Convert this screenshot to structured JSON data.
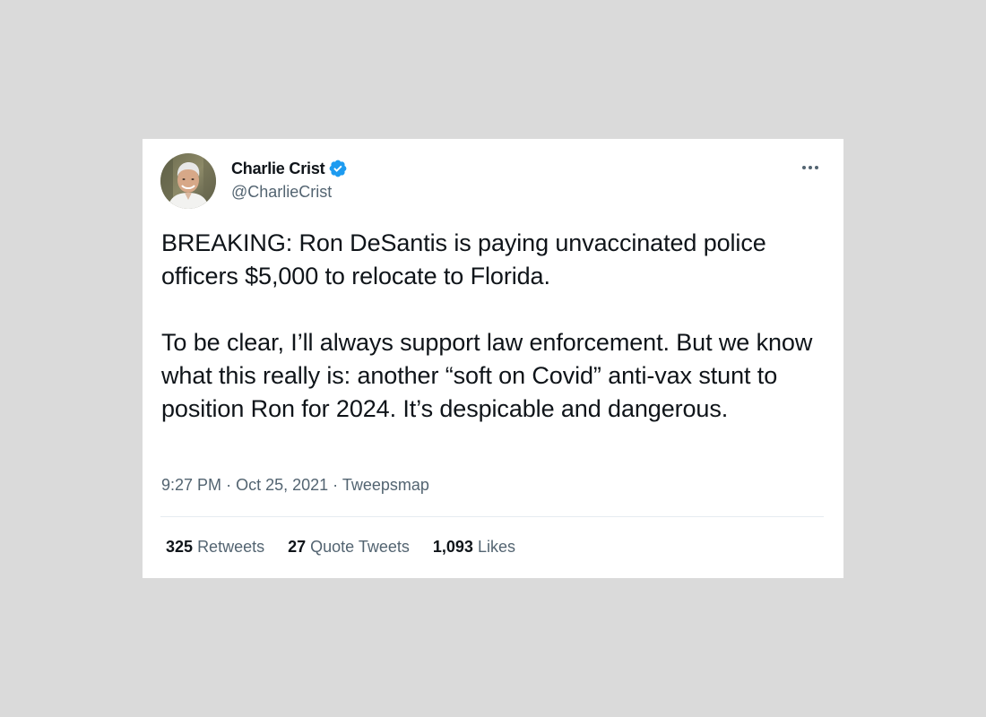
{
  "tweet": {
    "author": {
      "display_name": "Charlie Crist",
      "handle": "@CharlieCrist",
      "verified": true,
      "verified_color": "#1d9bf0"
    },
    "paragraphs": [
      "BREAKING: Ron DeSantis is paying unvaccinated police officers $5,000 to relocate to Florida.",
      "To be clear, I’ll always support law enforcement. But we know what this really is: another “soft on Covid” anti-vax stunt to position Ron for 2024. It’s despicable and dangerous."
    ],
    "time": "9:27 PM",
    "date": "Oct 25, 2021",
    "source": "Tweepsmap",
    "stats": {
      "retweets_count": "325",
      "retweets_label": "Retweets",
      "quotes_count": "27",
      "quotes_label": "Quote Tweets",
      "likes_count": "1,093",
      "likes_label": "Likes"
    }
  },
  "icons": {
    "verified": "verified-badge-icon",
    "more": "more-horizontal-icon"
  },
  "colors": {
    "background": "#dadada",
    "card": "#ffffff",
    "text_primary": "#0f1419",
    "text_secondary": "#536471"
  }
}
